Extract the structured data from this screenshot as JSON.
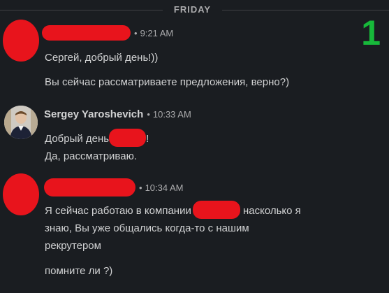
{
  "divider": {
    "label": "FRIDAY"
  },
  "step_badge": "1",
  "messages": [
    {
      "sender": "",
      "timestamp": "9:21 AM",
      "lines": [
        "Сергей, добрый день!))",
        "Вы сейчас рассматриваете предложения, верно?)"
      ]
    },
    {
      "sender": "Sergey Yaroshevich",
      "timestamp": "10:33 AM",
      "line1_before": "Добрый день",
      "line1_after": "!",
      "line2": "Да, рассматриваю."
    },
    {
      "sender": "",
      "timestamp": "10:34 AM",
      "line1_before": "Я сейчас работаю в компании",
      "line1_after": " насколько я",
      "line2": "знаю, Вы уже общались когда-то с нашим",
      "line3": "рекрутером",
      "line4": "помните ли ?)"
    }
  ],
  "colors": {
    "background": "#1a1d21",
    "text": "#d1d2d3",
    "muted": "#ababad",
    "redaction": "#e8141c",
    "badge": "#17b93a"
  }
}
